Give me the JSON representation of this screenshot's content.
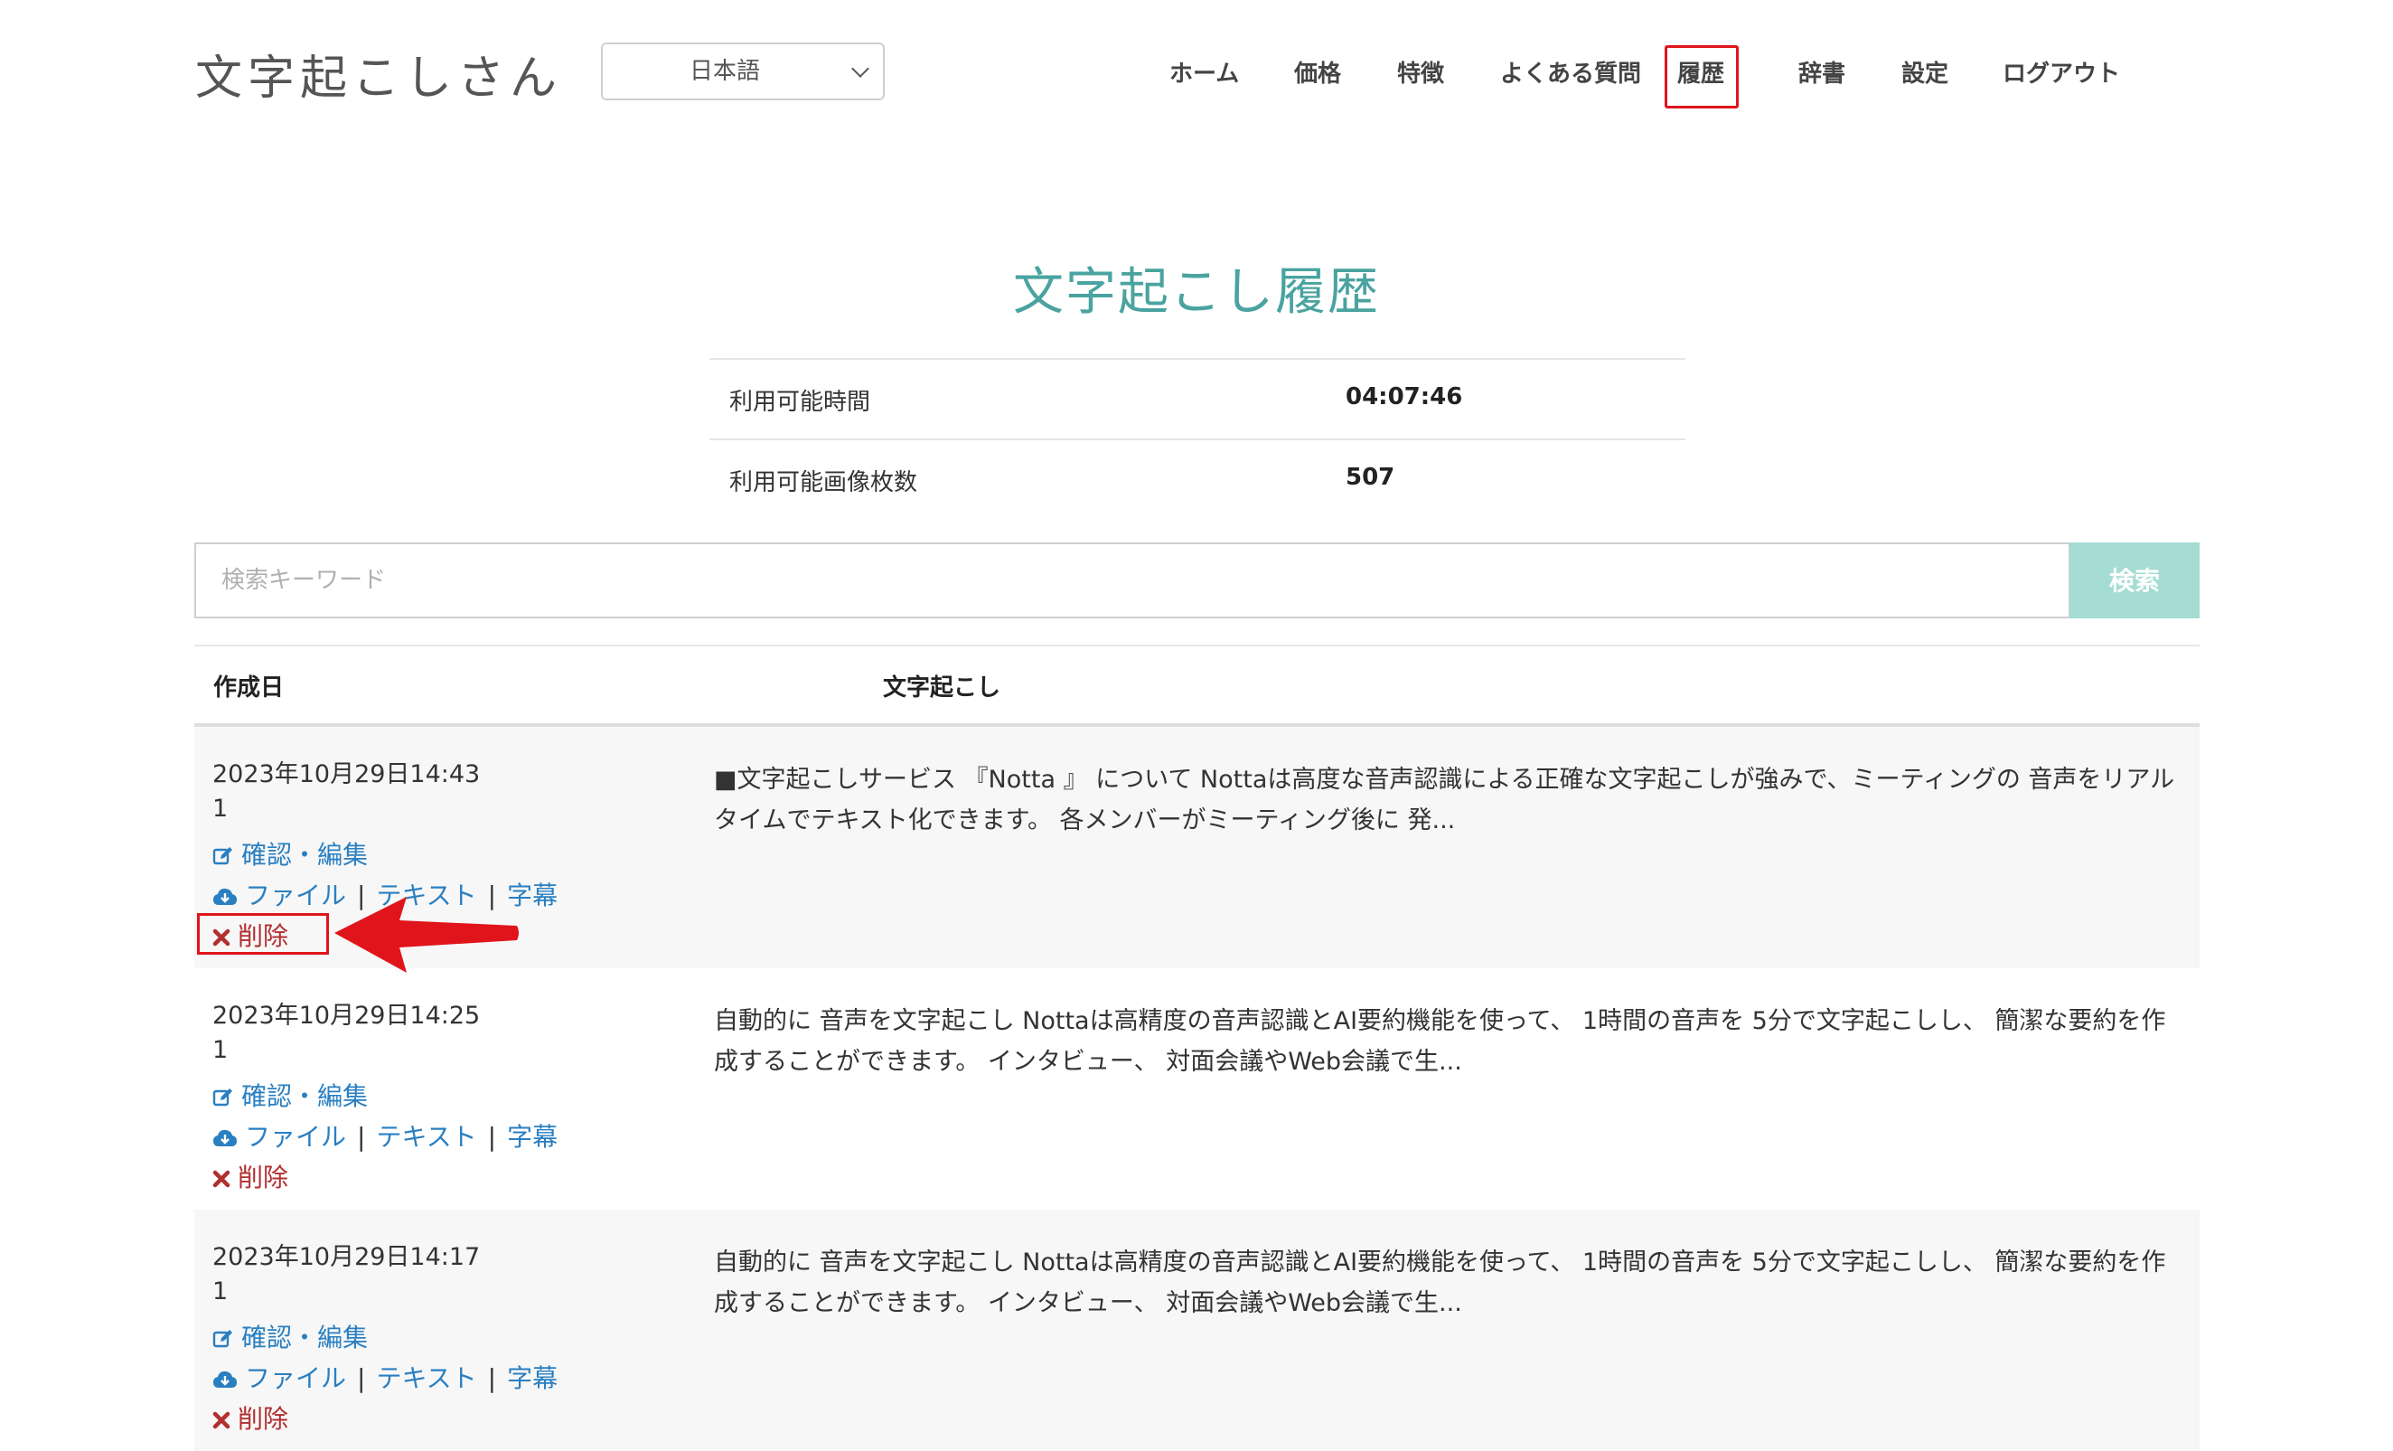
{
  "header": {
    "logo": "文字起こしさん",
    "language": "日本語",
    "nav": [
      {
        "label": "ホーム"
      },
      {
        "label": "価格"
      },
      {
        "label": "特徴"
      },
      {
        "label": "よくある質問"
      },
      {
        "label": "履歴"
      },
      {
        "label": "辞書"
      },
      {
        "label": "設定"
      },
      {
        "label": "ログアウト"
      }
    ]
  },
  "page": {
    "title": "文字起こし履歴",
    "stats": [
      {
        "label": "利用可能時間",
        "value": "04:07:46"
      },
      {
        "label": "利用可能画像枚数",
        "value": "507"
      }
    ]
  },
  "search": {
    "placeholder": "検索キーワード",
    "value": "",
    "button": "検索"
  },
  "table": {
    "headers": {
      "date": "作成日",
      "text": "文字起こし"
    },
    "actions": {
      "edit": "確認・編集",
      "file": "ファイル",
      "text": "テキスト",
      "subtitle": "字幕",
      "delete": "削除"
    },
    "rows": [
      {
        "date": "2023年10月29日14:43",
        "count": "1",
        "text": "■文字起こしサービス 『Notta 』 について Nottaは高度な音声認識による正確な文字起こしが強みで、ミーティングの 音声をリアルタイムでテキスト化できます。 各メンバーがミーティング後に 発..."
      },
      {
        "date": "2023年10月29日14:25",
        "count": "1",
        "text": "自動的に 音声を文字起こし Nottaは高精度の音声認識とAI要約機能を使って、 1時間の音声を 5分で文字起こしし、 簡潔な要約を作成することができます。 インタビュー、 対面会議やWeb会議で生..."
      },
      {
        "date": "2023年10月29日14:17",
        "count": "1",
        "text": "自動的に 音声を文字起こし Nottaは高精度の音声認識とAI要約機能を使って、 1時間の音声を 5分で文字起こしし、 簡潔な要約を作成することができます。 インタビュー、 対面会議やWeb会議で生..."
      }
    ]
  },
  "colors": {
    "accent": "#4aa3a0",
    "search_button": "#a5dcd4",
    "link": "#2a7fc1",
    "delete": "#b22f2f",
    "annotation": "#e0141b"
  },
  "icons": {
    "edit": "edit-icon",
    "download": "cloud-download-icon",
    "delete": "close-icon",
    "annotation": "red-arrow-icon"
  }
}
